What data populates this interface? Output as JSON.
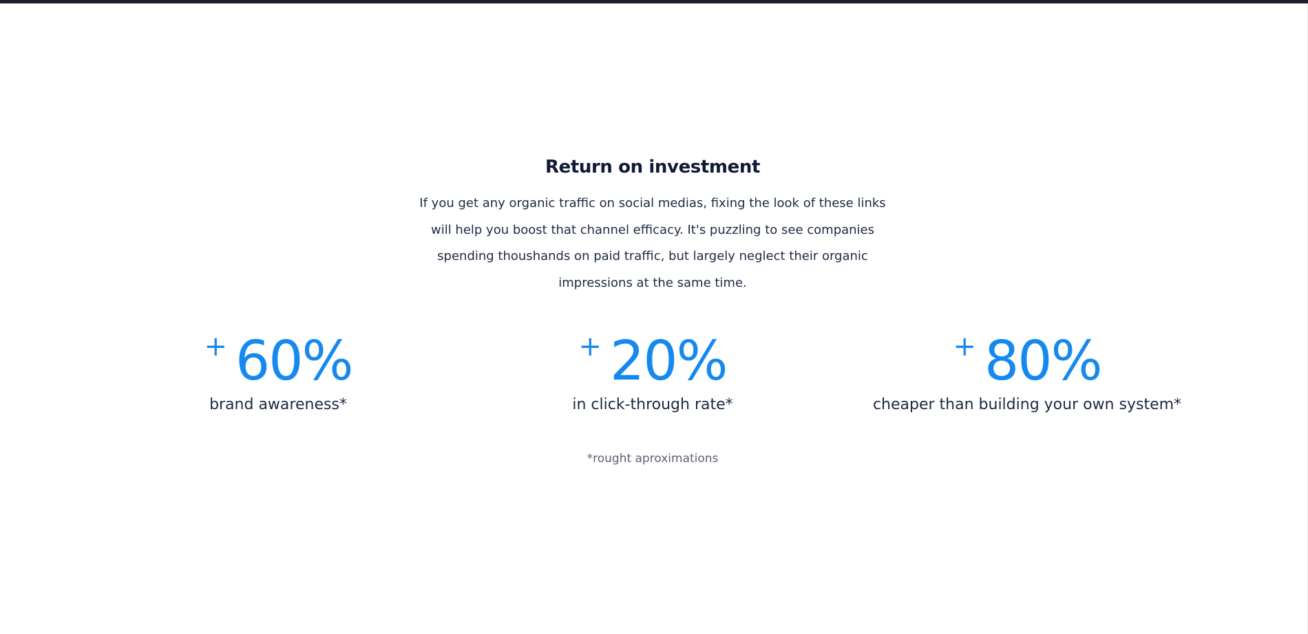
{
  "section": {
    "title": "Return on investment",
    "description": "If you get any organic traffic on social medias, fixing the look of these links will help you boost that channel efficacy. It's puzzling to see companies spending thoushands on paid traffic, but largely neglect their organic impressions at the same time.",
    "accent_color": "#1589f0",
    "text_color": "#1d2942"
  },
  "stats": [
    {
      "sign": "+",
      "value": "60%",
      "label": "brand awareness*"
    },
    {
      "sign": "+",
      "value": "20%",
      "label": "in click-through rate*"
    },
    {
      "sign": "+",
      "value": "80%",
      "label": "cheaper than building your own system*"
    }
  ],
  "footnote": "*rought aproximations"
}
